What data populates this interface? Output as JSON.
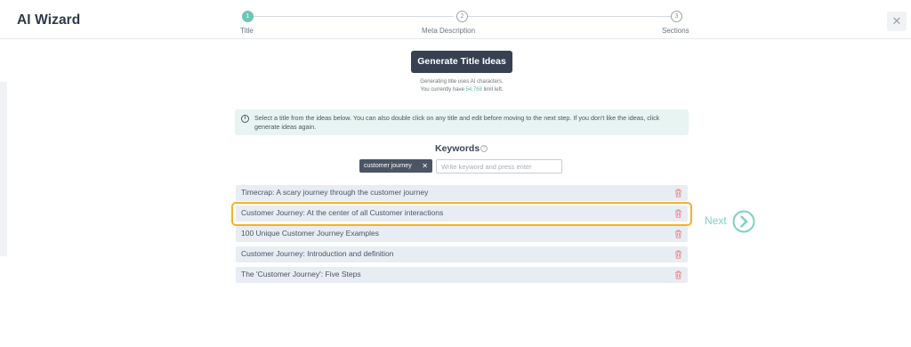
{
  "app": {
    "title": "AI Wizard",
    "close_label": "✕"
  },
  "stepper": {
    "steps": [
      {
        "number": "1",
        "label": "Title",
        "state": "active"
      },
      {
        "number": "2",
        "label": "Meta Description",
        "state": "inactive"
      },
      {
        "number": "3",
        "label": "Sections",
        "state": "inactive"
      }
    ]
  },
  "generate": {
    "button_label": "Generate Title Ideas",
    "note_line1": "Generating title uses AI characters.",
    "note_line2_prefix": "You currently have ",
    "note_line2_count": "54,768",
    "note_line2_suffix": " limit left."
  },
  "info": {
    "icon": "info-icon",
    "text": "Select a title from the ideas below. You can also double click on any title and edit before moving to the next step. If you don't like the ideas, click generate ideas again."
  },
  "keywords": {
    "title": "Keywords",
    "help_icon": "?",
    "chips": [
      {
        "label": "customer journey",
        "remove": "✕"
      }
    ],
    "input_placeholder": "Write keyword and press enter"
  },
  "ideas": [
    {
      "text": "Timecrap: A scary journey through the customer journey",
      "selected": false
    },
    {
      "text": "Customer Journey: At the center of all Customer interactions",
      "selected": true
    },
    {
      "text": "100 Unique Customer Journey Examples",
      "selected": false
    },
    {
      "text": "Customer Journey: Introduction and definition",
      "selected": false
    },
    {
      "text": "The 'Customer Journey': Five Steps",
      "selected": false
    }
  ],
  "next": {
    "label": "Next",
    "icon": "chevron-right-circle-icon"
  },
  "colors": {
    "accent": "#6fc6b5",
    "button_dark": "#374151",
    "selected_border": "#f4b12e",
    "trash": "#e88a8a",
    "info_bg": "#e7f4f1",
    "row_bg": "#e8edf3"
  }
}
